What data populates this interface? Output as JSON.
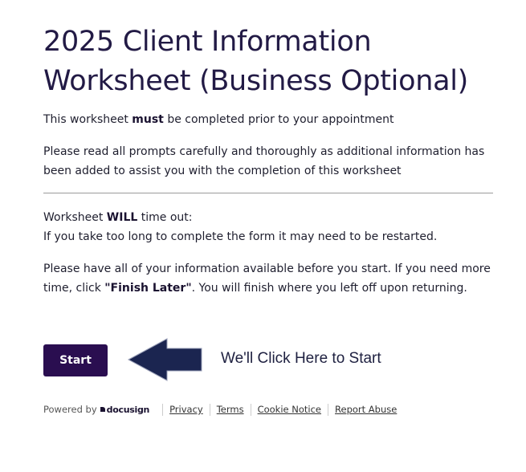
{
  "header": {
    "title": "2025 Client Information Worksheet (Business Optional)"
  },
  "intro": {
    "must_prefix": "This worksheet ",
    "must_bold": "must",
    "must_suffix": " be completed prior to your appointment",
    "read_prompts": "Please read all prompts carefully and thoroughly as additional information has been added to assist you with the completion of this worksheet"
  },
  "timeout": {
    "prefix": "Worksheet ",
    "bold": "WILL",
    "suffix": " time out:",
    "line2": "If you take too long to complete the form it may need to be restarted."
  },
  "info": {
    "prefix": "Please have all of your information available before you start. If you need more time, click ",
    "bold": "\"Finish Later\"",
    "suffix": ". You will finish where you left off upon returning."
  },
  "actions": {
    "start_label": "Start"
  },
  "annotation": {
    "text": "We'll Click Here to Start",
    "arrow_color": "#1b2550"
  },
  "footer": {
    "powered_by": "Powered by",
    "logo_text": "docusign",
    "links": [
      "Privacy",
      "Terms",
      "Cookie Notice",
      "Report Abuse"
    ]
  },
  "colors": {
    "title": "#221a45",
    "start_button": "#2a0e50"
  }
}
